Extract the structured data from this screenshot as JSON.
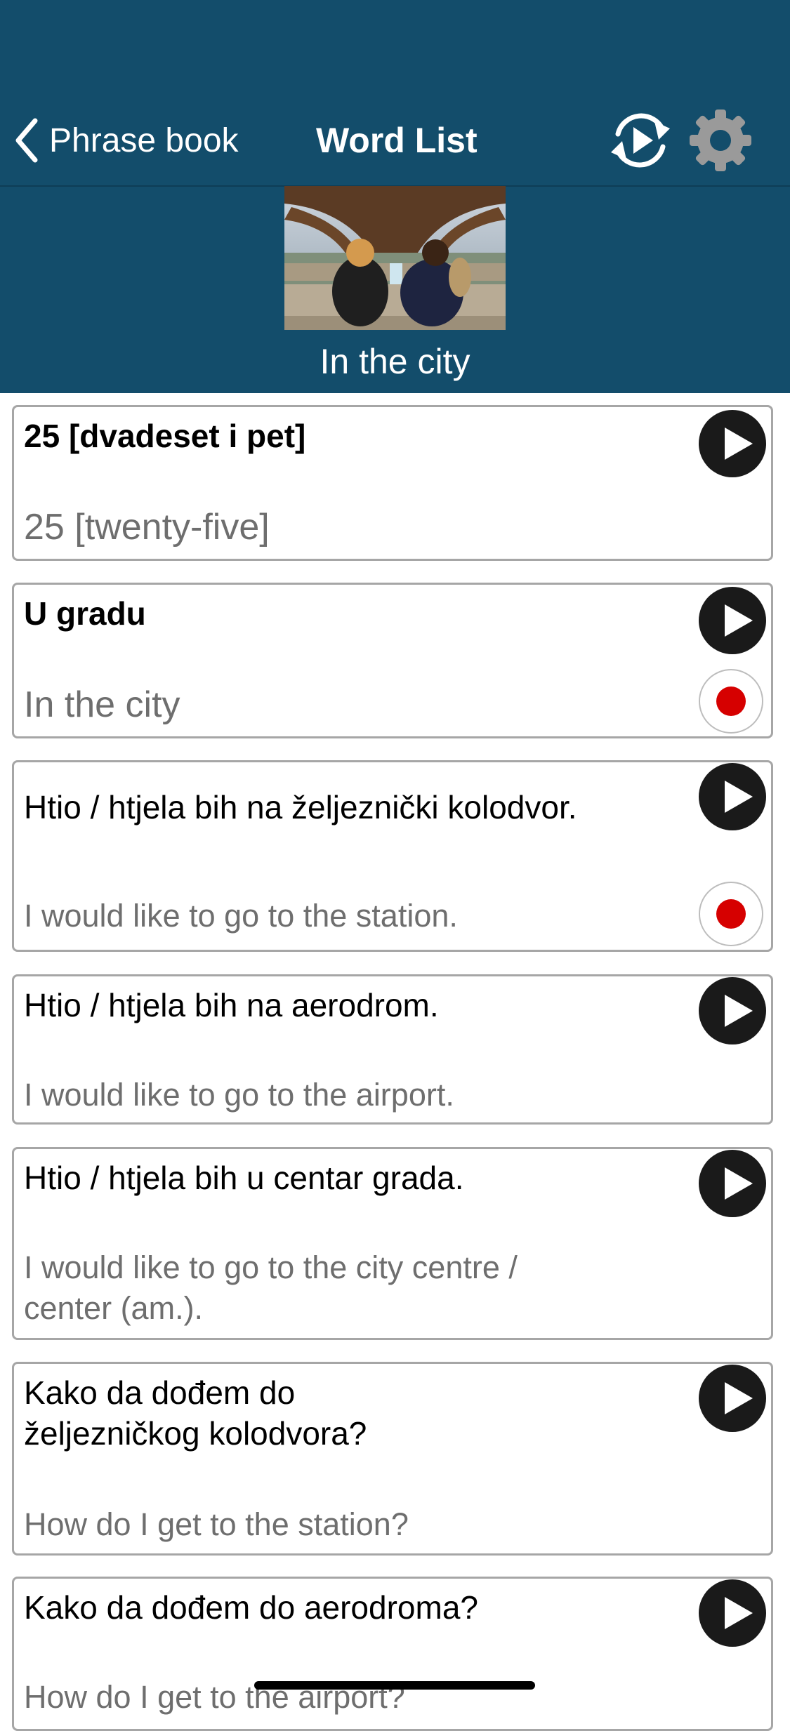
{
  "nav": {
    "back_label": "Phrase book",
    "title": "Word List"
  },
  "topic": {
    "title": "In the city"
  },
  "phrases": [
    {
      "native": "25 [dvadeset i pet]",
      "translation": "25 [twenty-five]"
    },
    {
      "native": "U gradu",
      "translation": "In the city"
    },
    {
      "native": "Htio / htjela bih na željeznički kolodvor.",
      "translation": "I would like to go to the station."
    },
    {
      "native": "Htio / htjela bih na aerodrom.",
      "translation": "I would like to go to the airport."
    },
    {
      "native": "Htio / htjela bih u centar grada.",
      "translation": "I would like to go to the city centre / center (am.)."
    },
    {
      "native": "Kako da dođem do željezničkog kolodvora?",
      "translation": "How do I get to the station?"
    },
    {
      "native": "Kako da dođem do aerodroma?",
      "translation": "How do I get to the airport?"
    }
  ],
  "icons": {
    "back": "chevron-left-icon",
    "replay": "replay-icon",
    "settings": "gear-icon",
    "play": "play-icon",
    "record": "record-icon"
  },
  "colors": {
    "header_bg": "#134d6b",
    "record_dot": "#d60000",
    "settings_gear": "#9a9a9a"
  }
}
